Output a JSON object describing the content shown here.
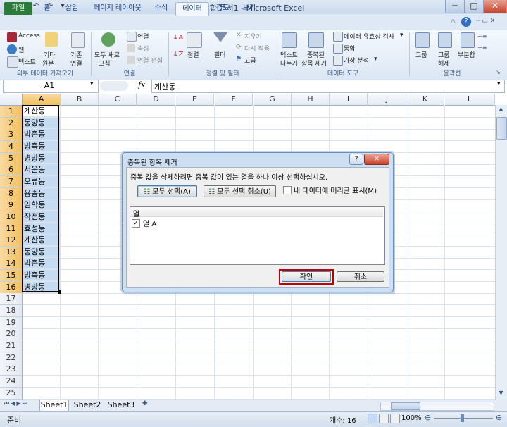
{
  "window": {
    "title": "통합 문서1 - Microsoft Excel",
    "controls": [
      "─",
      "□",
      "✕"
    ]
  },
  "ribbon": {
    "tabs": [
      "파일",
      "홈",
      "삽입",
      "페이지 레이아웃",
      "수식",
      "데이터",
      "검토",
      "보기"
    ],
    "active_tab": "데이터",
    "groups": {
      "external_data": {
        "label": "외부 데이터 가져오기",
        "access": "Access",
        "web": "웹",
        "text": "텍스트",
        "other_sources_1": "기타",
        "other_sources_2": "원본",
        "existing_1": "기존",
        "existing_2": "연결"
      },
      "connections": {
        "label": "연결",
        "refresh_all_1": "모두 새로",
        "refresh_all_2": "고침",
        "connections": "연결",
        "properties": "속성",
        "edit_links": "연결 편집"
      },
      "sort_filter": {
        "label": "정렬 및 필터",
        "sort": "정렬",
        "filter": "필터",
        "clear": "지우기",
        "reapply": "다시 적용",
        "advanced": "고급"
      },
      "data_tools": {
        "label": "데이터 도구",
        "text_to_columns_1": "텍스트",
        "text_to_columns_2": "나누기",
        "remove_dup_1": "중복된",
        "remove_dup_2": "항목 제거",
        "validation": "데이터 유효성 검사",
        "consolidate": "통합",
        "what_if": "가상 분석"
      },
      "outline": {
        "label": "윤곽선",
        "group": "그룹",
        "ungroup_1": "그룹",
        "ungroup_2": "해제",
        "subtotal": "부분합"
      }
    }
  },
  "formula_bar": {
    "name_box": "A1",
    "fx": "fx",
    "content": "계산동"
  },
  "grid": {
    "columns": [
      "A",
      "B",
      "C",
      "D",
      "E",
      "F",
      "G",
      "H",
      "I",
      "J",
      "K",
      "L"
    ],
    "rows": [
      "1",
      "2",
      "3",
      "4",
      "5",
      "6",
      "7",
      "8",
      "9",
      "10",
      "11",
      "12",
      "13",
      "14",
      "15",
      "16",
      "17",
      "18",
      "19",
      "20",
      "21",
      "22",
      "23",
      "24",
      "25"
    ],
    "column_a": [
      "계산동",
      "동양동",
      "박촌동",
      "방축동",
      "병방동",
      "서운동",
      "오류동",
      "용종동",
      "임학동",
      "작전동",
      "효성동",
      "계산동",
      "동양동",
      "박촌동",
      "방축동",
      "병방동"
    ]
  },
  "sheets": [
    "Sheet1",
    "Sheet2",
    "Sheet3"
  ],
  "status": {
    "mode": "준비",
    "count": "개수: 16",
    "zoom": "100%"
  },
  "dialog": {
    "title": "중복된 항목 제거",
    "instruction": "중복 값을 삭제하려면 중복 값이 있는 열을 하나 이상 선택하십시오.",
    "select_all": "모두 선택(A)",
    "unselect_all": "모두 선택 취소(U)",
    "has_headers": "내 데이터에 머리글 표시(M)",
    "list_header": "열",
    "list_items": [
      "열 A"
    ],
    "ok": "확인",
    "cancel": "취소",
    "help": "?",
    "close": "✕"
  }
}
